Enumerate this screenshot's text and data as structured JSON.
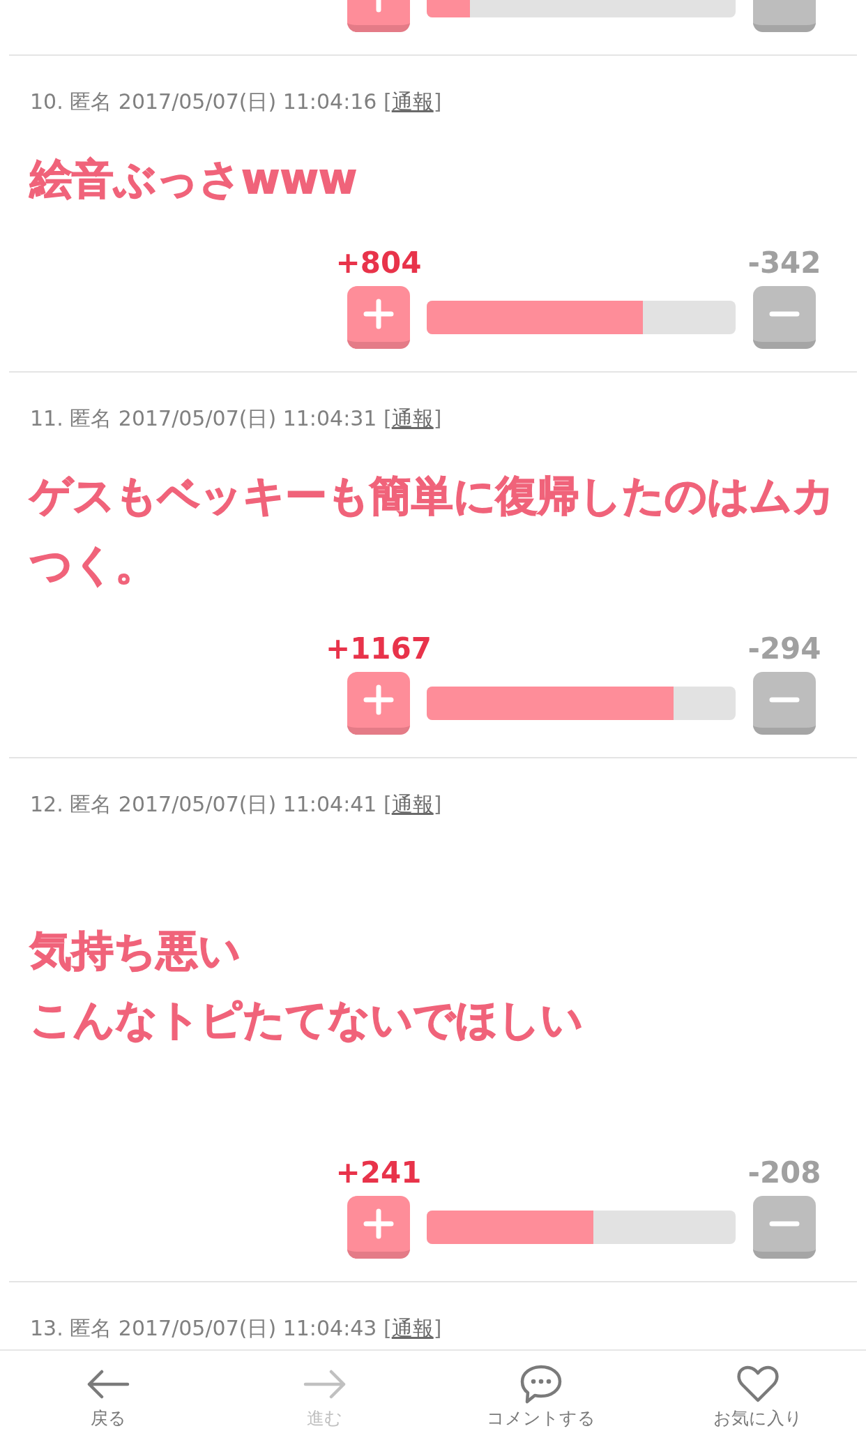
{
  "comments": [
    {
      "vote": {
        "level": 0.14
      }
    },
    {
      "header": {
        "number": "10.",
        "author": "匿名",
        "date": "2017/05/07(日)",
        "time": "11:04:16",
        "report_open": "[",
        "report": "通報",
        "report_close": "]"
      },
      "body": [
        "絵音ぶっさwww"
      ],
      "spaced": false,
      "vote": {
        "plus": "+804",
        "minus": "-342",
        "level": 0.7
      }
    },
    {
      "header": {
        "number": "11.",
        "author": "匿名",
        "date": "2017/05/07(日)",
        "time": "11:04:31",
        "report_open": "[",
        "report": "通報",
        "report_close": "]"
      },
      "body": [
        "ゲスもベッキーも簡単に復帰したのはムカつく。"
      ],
      "spaced": false,
      "vote": {
        "plus": "+1167",
        "minus": "-294",
        "level": 0.8
      }
    },
    {
      "header": {
        "number": "12.",
        "author": "匿名",
        "date": "2017/05/07(日)",
        "time": "11:04:41",
        "report_open": "[",
        "report": "通報",
        "report_close": "]"
      },
      "body": [
        "気持ち悪い",
        "こんなトピたてないでほしい"
      ],
      "spaced": true,
      "vote": {
        "plus": "+241",
        "minus": "-208",
        "level": 0.54
      }
    },
    {
      "header": {
        "number": "13.",
        "author": "匿名",
        "date": "2017/05/07(日)",
        "time": "11:04:43",
        "report_open": "[",
        "report": "通報",
        "report_close": "]"
      }
    }
  ],
  "bottom_nav": [
    {
      "kind": "back",
      "label": "戻る",
      "disabled": false
    },
    {
      "kind": "forward",
      "label": "進む",
      "disabled": true
    },
    {
      "kind": "comment",
      "label": "コメントする",
      "disabled": false
    },
    {
      "kind": "favorite",
      "label": "お気に入り",
      "disabled": false
    }
  ]
}
